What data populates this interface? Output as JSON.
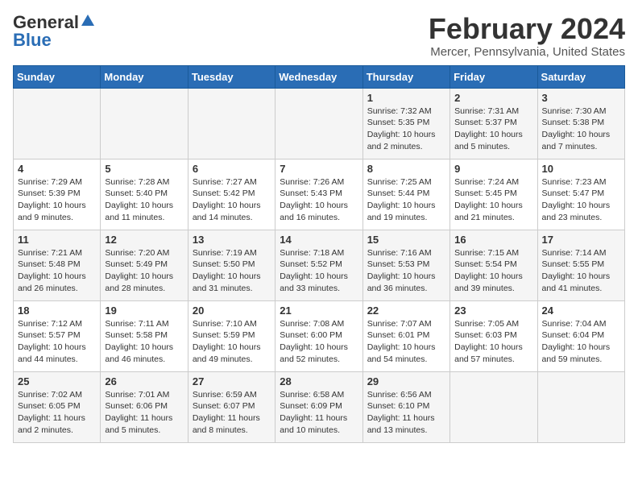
{
  "header": {
    "logo_general": "General",
    "logo_blue": "Blue",
    "month": "February 2024",
    "location": "Mercer, Pennsylvania, United States"
  },
  "days_of_week": [
    "Sunday",
    "Monday",
    "Tuesday",
    "Wednesday",
    "Thursday",
    "Friday",
    "Saturday"
  ],
  "weeks": [
    [
      {
        "day": "",
        "info": ""
      },
      {
        "day": "",
        "info": ""
      },
      {
        "day": "",
        "info": ""
      },
      {
        "day": "",
        "info": ""
      },
      {
        "day": "1",
        "info": "Sunrise: 7:32 AM\nSunset: 5:35 PM\nDaylight: 10 hours\nand 2 minutes."
      },
      {
        "day": "2",
        "info": "Sunrise: 7:31 AM\nSunset: 5:37 PM\nDaylight: 10 hours\nand 5 minutes."
      },
      {
        "day": "3",
        "info": "Sunrise: 7:30 AM\nSunset: 5:38 PM\nDaylight: 10 hours\nand 7 minutes."
      }
    ],
    [
      {
        "day": "4",
        "info": "Sunrise: 7:29 AM\nSunset: 5:39 PM\nDaylight: 10 hours\nand 9 minutes."
      },
      {
        "day": "5",
        "info": "Sunrise: 7:28 AM\nSunset: 5:40 PM\nDaylight: 10 hours\nand 11 minutes."
      },
      {
        "day": "6",
        "info": "Sunrise: 7:27 AM\nSunset: 5:42 PM\nDaylight: 10 hours\nand 14 minutes."
      },
      {
        "day": "7",
        "info": "Sunrise: 7:26 AM\nSunset: 5:43 PM\nDaylight: 10 hours\nand 16 minutes."
      },
      {
        "day": "8",
        "info": "Sunrise: 7:25 AM\nSunset: 5:44 PM\nDaylight: 10 hours\nand 19 minutes."
      },
      {
        "day": "9",
        "info": "Sunrise: 7:24 AM\nSunset: 5:45 PM\nDaylight: 10 hours\nand 21 minutes."
      },
      {
        "day": "10",
        "info": "Sunrise: 7:23 AM\nSunset: 5:47 PM\nDaylight: 10 hours\nand 23 minutes."
      }
    ],
    [
      {
        "day": "11",
        "info": "Sunrise: 7:21 AM\nSunset: 5:48 PM\nDaylight: 10 hours\nand 26 minutes."
      },
      {
        "day": "12",
        "info": "Sunrise: 7:20 AM\nSunset: 5:49 PM\nDaylight: 10 hours\nand 28 minutes."
      },
      {
        "day": "13",
        "info": "Sunrise: 7:19 AM\nSunset: 5:50 PM\nDaylight: 10 hours\nand 31 minutes."
      },
      {
        "day": "14",
        "info": "Sunrise: 7:18 AM\nSunset: 5:52 PM\nDaylight: 10 hours\nand 33 minutes."
      },
      {
        "day": "15",
        "info": "Sunrise: 7:16 AM\nSunset: 5:53 PM\nDaylight: 10 hours\nand 36 minutes."
      },
      {
        "day": "16",
        "info": "Sunrise: 7:15 AM\nSunset: 5:54 PM\nDaylight: 10 hours\nand 39 minutes."
      },
      {
        "day": "17",
        "info": "Sunrise: 7:14 AM\nSunset: 5:55 PM\nDaylight: 10 hours\nand 41 minutes."
      }
    ],
    [
      {
        "day": "18",
        "info": "Sunrise: 7:12 AM\nSunset: 5:57 PM\nDaylight: 10 hours\nand 44 minutes."
      },
      {
        "day": "19",
        "info": "Sunrise: 7:11 AM\nSunset: 5:58 PM\nDaylight: 10 hours\nand 46 minutes."
      },
      {
        "day": "20",
        "info": "Sunrise: 7:10 AM\nSunset: 5:59 PM\nDaylight: 10 hours\nand 49 minutes."
      },
      {
        "day": "21",
        "info": "Sunrise: 7:08 AM\nSunset: 6:00 PM\nDaylight: 10 hours\nand 52 minutes."
      },
      {
        "day": "22",
        "info": "Sunrise: 7:07 AM\nSunset: 6:01 PM\nDaylight: 10 hours\nand 54 minutes."
      },
      {
        "day": "23",
        "info": "Sunrise: 7:05 AM\nSunset: 6:03 PM\nDaylight: 10 hours\nand 57 minutes."
      },
      {
        "day": "24",
        "info": "Sunrise: 7:04 AM\nSunset: 6:04 PM\nDaylight: 10 hours\nand 59 minutes."
      }
    ],
    [
      {
        "day": "25",
        "info": "Sunrise: 7:02 AM\nSunset: 6:05 PM\nDaylight: 11 hours\nand 2 minutes."
      },
      {
        "day": "26",
        "info": "Sunrise: 7:01 AM\nSunset: 6:06 PM\nDaylight: 11 hours\nand 5 minutes."
      },
      {
        "day": "27",
        "info": "Sunrise: 6:59 AM\nSunset: 6:07 PM\nDaylight: 11 hours\nand 8 minutes."
      },
      {
        "day": "28",
        "info": "Sunrise: 6:58 AM\nSunset: 6:09 PM\nDaylight: 11 hours\nand 10 minutes."
      },
      {
        "day": "29",
        "info": "Sunrise: 6:56 AM\nSunset: 6:10 PM\nDaylight: 11 hours\nand 13 minutes."
      },
      {
        "day": "",
        "info": ""
      },
      {
        "day": "",
        "info": ""
      }
    ]
  ]
}
